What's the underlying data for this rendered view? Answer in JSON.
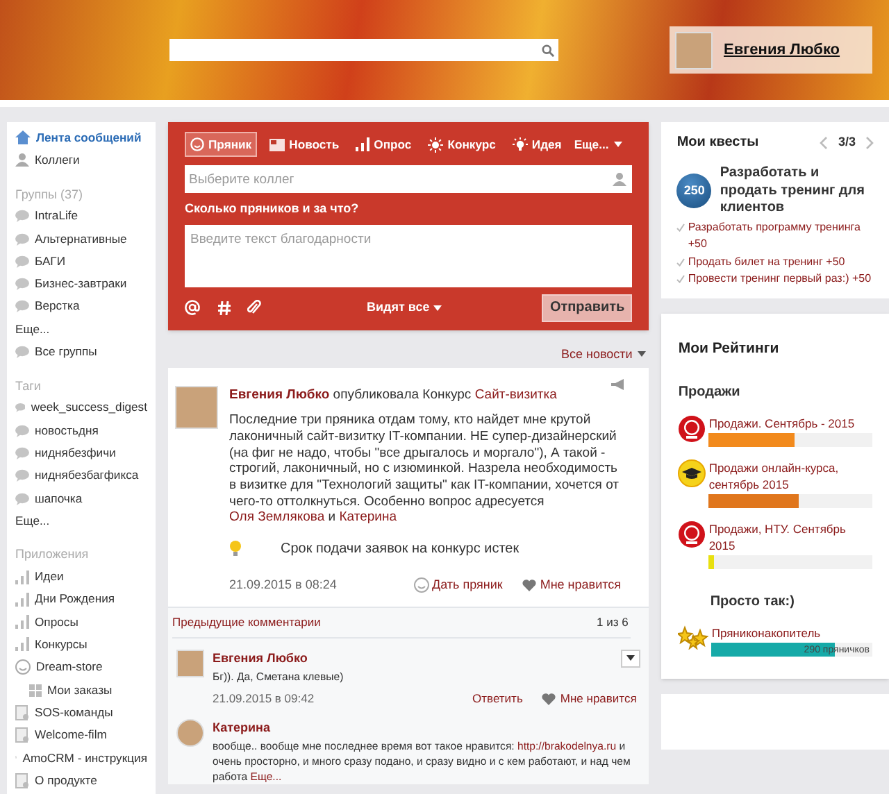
{
  "header": {
    "user": {
      "name": "Евгения Любко"
    }
  },
  "sidebar": {
    "sections": [
      {
        "items": [
          {
            "kind": "feed",
            "label": "Лента сообщений",
            "selected": true
          },
          {
            "kind": "person",
            "label": "Коллеги",
            "selected": false
          }
        ]
      },
      {
        "heading": "Группы (37)",
        "items": [
          {
            "kind": "group",
            "label": "IntraLife",
            "selected": false
          },
          {
            "kind": "group",
            "label": "Альтернативные",
            "selected": false
          },
          {
            "kind": "group",
            "label": "БАГИ",
            "selected": false
          },
          {
            "kind": "group",
            "label": "Бизнес-завтраки",
            "selected": false
          },
          {
            "kind": "group",
            "label": "Верстка",
            "selected": false
          },
          {
            "kind": "more",
            "label": "Еще...",
            "selected": false
          },
          {
            "kind": "group",
            "label": "Все группы",
            "selected": false
          }
        ]
      },
      {
        "heading": "Таги",
        "items": [
          {
            "kind": "group",
            "label": "week_success_digest",
            "selected": false
          },
          {
            "kind": "group",
            "label": "новостьдня",
            "selected": false
          },
          {
            "kind": "group",
            "label": "ниднябезфичи",
            "selected": false
          },
          {
            "kind": "group",
            "label": "ниднябезбагфикса",
            "selected": false
          },
          {
            "kind": "group",
            "label": "шапочка",
            "selected": false
          },
          {
            "kind": "more",
            "label": "Еще...",
            "selected": false
          }
        ]
      },
      {
        "heading": "Приложения",
        "items": [
          {
            "kind": "app",
            "label": "Идеи",
            "selected": false
          },
          {
            "kind": "app",
            "label": "Дни Рождения",
            "selected": false
          },
          {
            "kind": "app",
            "label": "Опросы",
            "selected": false
          },
          {
            "kind": "app",
            "label": "Конкурсы",
            "selected": false
          },
          {
            "kind": "store",
            "label": "Dream-store",
            "selected": false
          },
          {
            "kind": "sub",
            "label": "Мои заказы",
            "selected": false
          },
          {
            "kind": "doc",
            "label": "SOS-команды",
            "selected": false
          },
          {
            "kind": "doc",
            "label": "Welcome-film",
            "selected": false
          },
          {
            "kind": "doc",
            "label": "AmoCRM - инструкция",
            "selected": false
          },
          {
            "kind": "doc",
            "label": "О продукте",
            "selected": false
          }
        ]
      }
    ]
  },
  "composer": {
    "tabs": [
      {
        "label": "Пряник",
        "selected": true
      },
      {
        "label": "Новость",
        "selected": false
      },
      {
        "label": "Опрос",
        "selected": false
      },
      {
        "label": "Конкурс",
        "selected": false
      },
      {
        "label": "Идея",
        "selected": false
      }
    ],
    "more": "Еще...",
    "colleagues": {
      "placeholder": "Выберите коллег"
    },
    "question": "Сколько пряников и за что?",
    "message": {
      "placeholder": "Введите текст благодарности"
    },
    "visibility": "Видят все",
    "send": "Отправить"
  },
  "filter": "Все новости",
  "post": {
    "author": "Евгения Любко",
    "action": "опубликовала Конкурс",
    "target": "Сайт-визитка",
    "body": [
      {
        "kind": "text",
        "text": "Последние три пряника отдам тому, кто найдет мне крутой лаконичный сайт-визитку IT-компании. НЕ супер-дизайнерский (на фиг не надо, чтобы \"все дрыгалось и моргало\"), А такой - строгий, лаконичный, но с изюминкой. Назрела необходимость в визитке для \"Технологий защиты\" как IT-компании, хочется от чего-то оттолкнуться. Особенно вопрос адресуется "
      },
      {
        "kind": "link",
        "text": "Оля Землякова"
      },
      {
        "kind": "text",
        "text": " и "
      },
      {
        "kind": "link",
        "text": "Катерина"
      }
    ],
    "notice": "Срок подачи заявок на конкурс истек",
    "date": "21.09.2015 в 08:24",
    "give": "Дать пряник",
    "like": "Мне нравится",
    "previous": "Предыдущие комментарии",
    "count": "1 из 6",
    "comments": [
      {
        "author": "Евгения Любко",
        "body": [
          {
            "kind": "text",
            "text": "Бг)). Да, Сметана клевые)"
          }
        ],
        "date": "21.09.2015 в 09:42",
        "reply": "Ответить",
        "like": "Мне нравится"
      },
      {
        "author": "Катерина",
        "body": [
          {
            "kind": "text",
            "text": "вообще.. вообще мне последнее время вот такое нравится: "
          },
          {
            "kind": "link",
            "text": "http://brakodelnya.ru"
          },
          {
            "kind": "text",
            "text": " и очень просторно, и много сразу подано, и сразу видно и с кем работают, и над чем работа "
          },
          {
            "kind": "link",
            "text": "Еще..."
          }
        ]
      }
    ]
  },
  "quests": {
    "title": "Мои квесты",
    "pager": "3/3",
    "points": "250",
    "name": "Разработать и продать тренинг для клиентов",
    "tasks": [
      {
        "label": "Разработать программу тренинга +50",
        "checked": true
      },
      {
        "label": "Продать билет на тренинг +50",
        "checked": true
      },
      {
        "label": "Провести тренинг первый раз:) +50",
        "checked": true
      }
    ]
  },
  "ratings": {
    "title": "Мои Рейтинги",
    "groups": [
      {
        "heading": "Продажи",
        "items": [
          {
            "label": "Продажи. Сентябрь - 2015",
            "level": 0.52,
            "color": "#f28a1c"
          },
          {
            "label": "Продажи онлайн-курса, сентябрь 2015",
            "level": 0.55,
            "color": "#e0761c"
          },
          {
            "label": "Продажи, НТУ. Сентябрь 2015",
            "level": 0.03,
            "color": "#e8e010"
          }
        ]
      },
      {
        "heading": "Просто так:)",
        "items": [
          {
            "label": "Пряниконакопитель",
            "level": 0.77,
            "color": "#16aaa8",
            "reading": "290 пряничков"
          }
        ]
      }
    ]
  }
}
